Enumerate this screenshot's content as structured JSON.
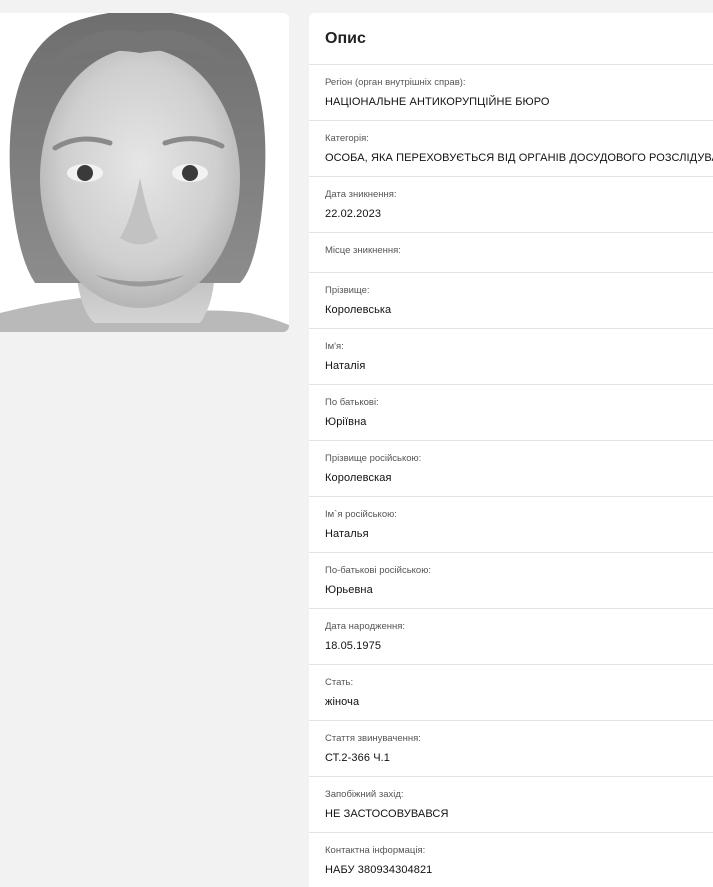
{
  "description": {
    "title": "Опис",
    "fields": [
      {
        "label": "Регіон (орган внутрішніх справ):",
        "value": "НАЦІОНАЛЬНЕ АНТИКОРУПЦІЙНЕ БЮРО"
      },
      {
        "label": "Категорія:",
        "value": "ОСОБА, ЯКА ПЕРЕХОВУЄТЬСЯ ВІД ОРГАНІВ ДОСУДОВОГО РОЗСЛІДУВАННЯ"
      },
      {
        "label": "Дата зникнення:",
        "value": "22.02.2023"
      },
      {
        "label": "Місце зникнення:",
        "value": ""
      },
      {
        "label": "Прізвище:",
        "value": "Королевська"
      },
      {
        "label": "Ім'я:",
        "value": "Наталія"
      },
      {
        "label": "По батькові:",
        "value": "Юріївна"
      },
      {
        "label": "Прізвище російською:",
        "value": "Королевская"
      },
      {
        "label": "Ім`я російською:",
        "value": "Наталья"
      },
      {
        "label": "По-батькові російською:",
        "value": "Юрьевна"
      },
      {
        "label": "Дата народження:",
        "value": "18.05.1975"
      },
      {
        "label": "Стать:",
        "value": "жіноча"
      },
      {
        "label": "Стаття звинувачення:",
        "value": "СТ.2-366 Ч.1"
      },
      {
        "label": "Запобіжний захід:",
        "value": "НЕ ЗАСТОСОВУВАВСЯ"
      },
      {
        "label": "Контактна інформація:",
        "value": "НАБУ 380934304821"
      }
    ]
  }
}
